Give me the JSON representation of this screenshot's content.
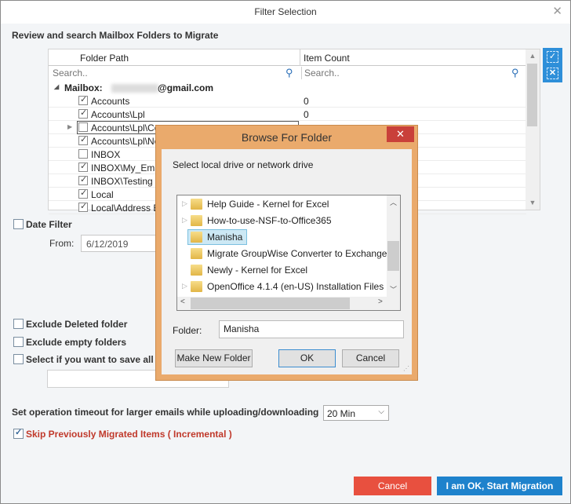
{
  "window": {
    "title": "Filter Selection",
    "close_glyph": "✕"
  },
  "section_heading": "Review and search Mailbox Folders to Migrate",
  "grid": {
    "columns": [
      "Folder Path",
      "Item Count"
    ],
    "search_placeholder": [
      "Search..",
      "Search.."
    ],
    "mailbox_label": "Mailbox:",
    "mailbox_domain": "@gmail.com",
    "rows": [
      {
        "path": "Accounts",
        "count": "0",
        "checked": true
      },
      {
        "path": "Accounts\\Lpl",
        "count": "0",
        "checked": true
      },
      {
        "path": "Accounts\\Lpl\\Co",
        "count": "",
        "checked": false,
        "focused": true,
        "expandable": true
      },
      {
        "path": "Accounts\\Lpl\\No",
        "count": "",
        "checked": true
      },
      {
        "path": "INBOX",
        "count": "",
        "checked": false
      },
      {
        "path": "INBOX\\My_Email",
        "count": "",
        "checked": true
      },
      {
        "path": "INBOX\\Testing M",
        "count": "",
        "checked": true
      },
      {
        "path": "Local",
        "count": "",
        "checked": true
      },
      {
        "path": "Local\\Address Bo",
        "count": "",
        "checked": true
      }
    ]
  },
  "side_tools": {
    "select_all": "✓",
    "clear_all": "✕"
  },
  "date_filter": {
    "label": "Date Filter",
    "checked": false,
    "from_label": "From:",
    "from_value": "6/12/2019"
  },
  "options": {
    "exclude_deleted": {
      "label": "Exclude Deleted folder",
      "checked": false
    },
    "exclude_empty": {
      "label": "Exclude empty folders",
      "checked": false
    },
    "save_all": {
      "label": "Select if you want to save all dat",
      "checked": false
    }
  },
  "timeout": {
    "label": "Set operation timeout for larger emails while uploading/downloading",
    "value": "20 Min"
  },
  "incremental": {
    "label": "Skip Previously Migrated Items ( Incremental )",
    "checked": true
  },
  "buttons": {
    "cancel": "Cancel",
    "start": "I am OK, Start Migration"
  },
  "browse_dialog": {
    "title": "Browse For Folder",
    "close_glyph": "✕",
    "prompt": "Select local drive or network drive",
    "items": [
      {
        "name": "Help Guide - Kernel for Excel",
        "expandable": true
      },
      {
        "name": "How-to-use-NSF-to-Office365",
        "expandable": true
      },
      {
        "name": "Manisha",
        "expandable": false,
        "selected": true
      },
      {
        "name": "Migrate GroupWise Converter to Exchange (",
        "expandable": false
      },
      {
        "name": "Newly - Kernel for Excel",
        "expandable": false
      },
      {
        "name": "OpenOffice 4.1.4 (en-US) Installation Files",
        "expandable": true
      }
    ],
    "folder_label": "Folder:",
    "folder_value": "Manisha",
    "make_new_folder": "Make New Folder",
    "ok": "OK",
    "cancel": "Cancel"
  }
}
